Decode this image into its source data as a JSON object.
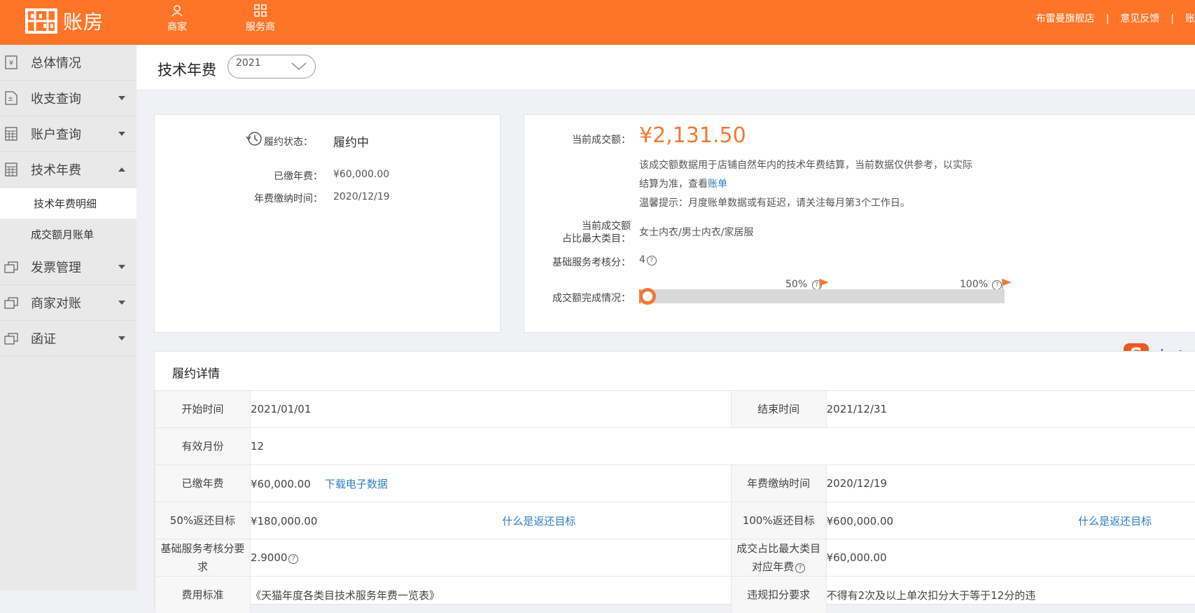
{
  "header": {
    "logo_text": "账房",
    "nav": [
      {
        "label": "商家",
        "icon": "user-icon"
      },
      {
        "label": "服务商",
        "icon": "grid-icon"
      }
    ],
    "store_name": "布雷曼旗舰店",
    "separator": "|",
    "feedback": "意见反馈",
    "extra": "账"
  },
  "sidebar": {
    "items": [
      {
        "label": "总体情况",
        "icon": "yen-doc-icon"
      },
      {
        "label": "收支查询",
        "icon": "plus-minus-doc-icon"
      },
      {
        "label": "账户查询",
        "icon": "calculator-icon"
      },
      {
        "label": "技术年费",
        "icon": "calculator-icon"
      },
      {
        "label": "发票管理",
        "icon": "stacked-cards-icon"
      },
      {
        "label": "商家对账",
        "icon": "stacked-cards-icon"
      },
      {
        "label": "函证",
        "icon": "stacked-cards-icon"
      }
    ],
    "sub_items": [
      "技术年费明细",
      "成交额月账单"
    ]
  },
  "page": {
    "title": "技术年费",
    "year_selected": "2021"
  },
  "status_card": {
    "status_label": "履约状态：",
    "status_value": "履约中",
    "paid_label": "已缴年费：",
    "paid_value": "¥60,000.00",
    "paid_time_label": "年费缴纳时间：",
    "paid_time_value": "2020/12/19"
  },
  "sales_card": {
    "current_label": "当前成交额：",
    "current_value": "¥2,131.50",
    "note_line1": "该成交额数据用于店铺自然年内的技术年费结算，当前数据仅供参考，以实际",
    "note_line2": "结算为准，查看",
    "note_link": "账单",
    "tip": "温馨提示：月度账单数据或有延迟，请关注每月第3个工作日。",
    "category_label_1": "当前成交额",
    "category_label_2": "占比最大类目：",
    "category_value": "女士内衣/男士内衣/家居服",
    "score_label": "基础服务考核分：",
    "score_value": "4",
    "progress_label": "成交额完成情况：",
    "progress_fraction": 0.0036,
    "mark_50": "50%",
    "mark_100": "100%",
    "accent_color": "#f07a36"
  },
  "ime": {
    "lang": "中"
  },
  "detail": {
    "title": "履约详情",
    "rows": {
      "start_label": "开始时间",
      "start_value": "2021/01/01",
      "end_label": "结束时间",
      "end_value": "2021/12/31",
      "months_label": "有效月份",
      "months_value": "12",
      "paid_label": "已缴年费",
      "paid_value": "¥60,000.00",
      "download": "下载电子数据",
      "paid_time_label": "年费缴纳时间",
      "paid_time_value": "2020/12/19",
      "rebate50_label": "50%返还目标",
      "rebate50_value": "¥180,000.00",
      "rebate_link": "什么是返还目标",
      "rebate100_label": "100%返还目标",
      "rebate100_value": "¥600,000.00",
      "score_req_label": "基础服务考核分要求",
      "score_req_value": "2.9000",
      "max_cat_label": "成交占比最大类目对应年费",
      "max_cat_value": "¥60,000.00",
      "fee_std_label": "费用标准",
      "fee_std_value": "《天猫年度各类目技术服务年费一览表》",
      "violation_label": "违规扣分要求",
      "violation_value": "不得有2次及以上单次扣分大于等于12分的违"
    }
  }
}
